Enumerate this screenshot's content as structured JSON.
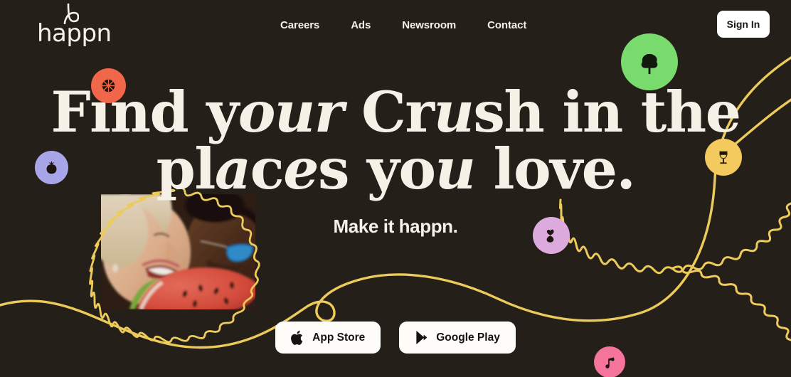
{
  "page": {
    "background_color": "#251f19",
    "text_color": "#f6f1e7",
    "accent_line_color": "#eccb5a"
  },
  "header": {
    "brand": {
      "name": "happn",
      "icon": "happn-logo-icon"
    },
    "nav_items": [
      {
        "label": "Careers"
      },
      {
        "label": "Ads"
      },
      {
        "label": "Newsroom"
      },
      {
        "label": "Contact"
      }
    ],
    "sign_in_label": "Sign In"
  },
  "hero": {
    "headline_line1_a": "Find y",
    "headline_line1_b": "o",
    "headline_line1_c": "ur",
    "headline_line1_d": " Cr",
    "headline_line1_e": "u",
    "headline_line1_f": "sh in the",
    "headline_line2_a": "pl",
    "headline_line2_b": "a",
    "headline_line2_c": "c",
    "headline_line2_d": "e",
    "headline_line2_e": "s yo",
    "headline_line2_f": "u",
    "headline_line2_g": " love.",
    "headline_plain": "Find your Crush in the places you love.",
    "tagline": "Make it happn."
  },
  "store_buttons": [
    {
      "label": "App Store",
      "icon": "apple-icon"
    },
    {
      "label": "Google Play",
      "icon": "google-play-icon"
    }
  ],
  "decorations": {
    "photo": {
      "name": "couple-eating-watermelon-photo"
    },
    "badges": [
      {
        "id": "basketball",
        "icon": "basketball-icon",
        "color": "#f2674a"
      },
      {
        "id": "berry",
        "icon": "strawberry-icon",
        "color": "#a8a6e8"
      },
      {
        "id": "tree",
        "icon": "tree-icon",
        "color": "#79da6e"
      },
      {
        "id": "wine",
        "icon": "wine-glass-icon",
        "color": "#f4ca5e"
      },
      {
        "id": "heart",
        "icon": "heart-balloon-icon",
        "color": "#ddaade"
      },
      {
        "id": "music",
        "icon": "music-note-icon",
        "color": "#f4749c"
      }
    ],
    "squiggle_color": "#eccb5a"
  }
}
